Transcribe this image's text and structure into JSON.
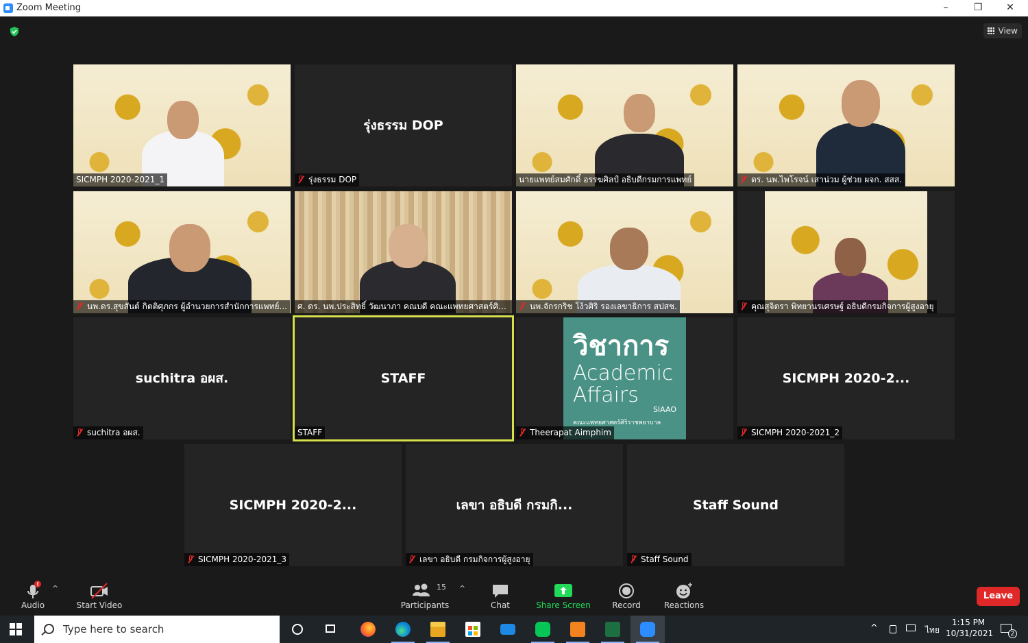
{
  "window": {
    "title": "Zoom Meeting",
    "controls": [
      "–",
      "❐",
      "✕"
    ]
  },
  "meeting": {
    "view_label": "View",
    "accent_active": "#d6e04a",
    "tiles": [
      {
        "label": "SICMPH 2020-2021_1",
        "kind": "video",
        "muted": false
      },
      {
        "label": "รุ่งธรรม DOP",
        "center": "รุ่งธรรม DOP",
        "kind": "name",
        "muted": true
      },
      {
        "label": "นายแพทย์สมศักดิ์ อรรฆศิลป์ อธิบดีกรมการแพทย์",
        "kind": "video",
        "muted": false
      },
      {
        "label": "ดร. นพ.ไพโรจน์ เสาน่วม ผู้ช่วย ผจก. สสส.",
        "kind": "video",
        "muted": true
      },
      {
        "label": "นพ.ดร.สุขสันต์ กิตติศุภกร ผู้อำนวยการสำนักการแพทย์...",
        "kind": "video",
        "muted": true
      },
      {
        "label": "ศ. ดร. นพ.ประสิทธิ์ วัฒนาภา คณบดี คณะแพทยศาสตร์ศิริ...",
        "kind": "video",
        "muted": false
      },
      {
        "label": "นพ.จักรกริช โง้วศิริ รองเลขาธิการ สปสช.",
        "kind": "video",
        "muted": true
      },
      {
        "label": "คุณสุจิตรา พิทยานรเศรษฐ์ อธิบดีกรมกิจการผู้สูงอายุ",
        "kind": "video",
        "muted": true
      },
      {
        "label": "suchitra อผส.",
        "center": "suchitra อผส.",
        "kind": "name",
        "muted": true
      },
      {
        "label": "STAFF",
        "center": "STAFF",
        "kind": "name",
        "muted": false,
        "active": true
      },
      {
        "label": "Theerapat Aimphim",
        "kind": "share",
        "muted": true
      },
      {
        "label": "SICMPH 2020-2021_2",
        "center": "SICMPH 2020-2...",
        "kind": "name",
        "muted": true
      },
      {
        "label": "SICMPH 2020-2021_3",
        "center": "SICMPH 2020-2...",
        "kind": "name",
        "muted": true
      },
      {
        "label": "เลขา อธิบดี กรมกิจการผู้สูงอายุ",
        "center": "เลขา อธิบดี กรมกิ...",
        "kind": "name",
        "muted": true
      },
      {
        "label": "Staff  Sound",
        "center": "Staff  Sound",
        "kind": "name",
        "muted": true
      }
    ],
    "academic_card": {
      "thai": "วิชาการ",
      "en_line1": "Academic",
      "en_line2": "Affairs",
      "org": "SIAAO",
      "faculty": "คณะแพทยศาสตร์ศิริราชพยาบาล"
    }
  },
  "toolbar": {
    "audio": "Audio",
    "start_video": "Start Video",
    "participants": "Participants",
    "participants_count": "15",
    "chat": "Chat",
    "share_screen": "Share Screen",
    "record": "Record",
    "reactions": "Reactions",
    "leave": "Leave",
    "share_color": "#23d959",
    "leave_color": "#e02828"
  },
  "taskbar": {
    "search_placeholder": "Type here to search",
    "time": "1:15 PM",
    "date": "10/31/2021",
    "lang": "ไทย",
    "notifications": "2",
    "apps": [
      "task-view-icon",
      "firefox-icon",
      "edge-icon",
      "file-explorer-icon",
      "store-icon",
      "mail-icon",
      "line-icon",
      "slides-icon",
      "excel-icon",
      "zoom-icon"
    ]
  }
}
